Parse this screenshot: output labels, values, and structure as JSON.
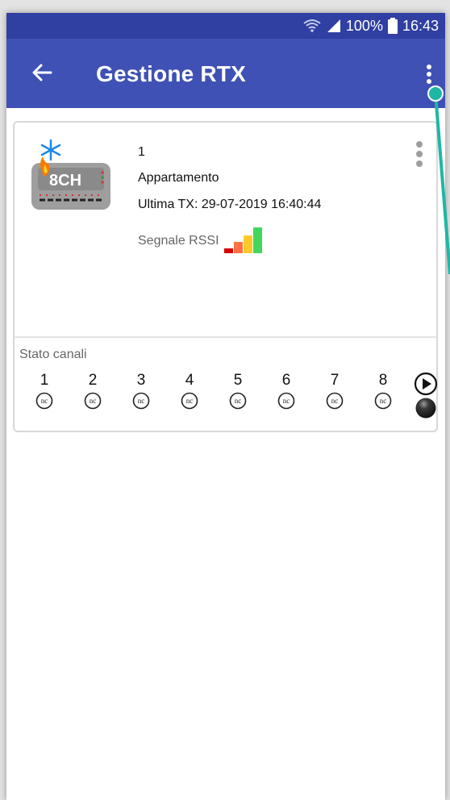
{
  "status_bar": {
    "battery": "100%",
    "time": "16:43",
    "icons": [
      "wifi-icon",
      "signal-icon",
      "battery-icon"
    ]
  },
  "app_bar": {
    "title": "Gestione RTX",
    "back_icon": "arrow-left-icon",
    "menu_icon": "more-vert-icon"
  },
  "device": {
    "id": "1",
    "name": "Appartamento",
    "last_tx": "Ultima TX: 29-07-2019 16:40:44",
    "rssi_label": "Segnale RSSI",
    "rssi_bars": 4,
    "image_text": "8CH",
    "image_icon": "thermostat-8ch-icon"
  },
  "channels": {
    "label": "Stato canali",
    "items": [
      {
        "num": "1",
        "status": "nc"
      },
      {
        "num": "2",
        "status": "nc"
      },
      {
        "num": "3",
        "status": "nc"
      },
      {
        "num": "4",
        "status": "nc"
      },
      {
        "num": "5",
        "status": "nc"
      },
      {
        "num": "6",
        "status": "nc"
      },
      {
        "num": "7",
        "status": "nc"
      },
      {
        "num": "8",
        "status": "nc"
      }
    ]
  },
  "colors": {
    "status_bar": "#2f3fa2",
    "app_bar": "#3f51b5",
    "annotation": "#1fb6a6"
  }
}
